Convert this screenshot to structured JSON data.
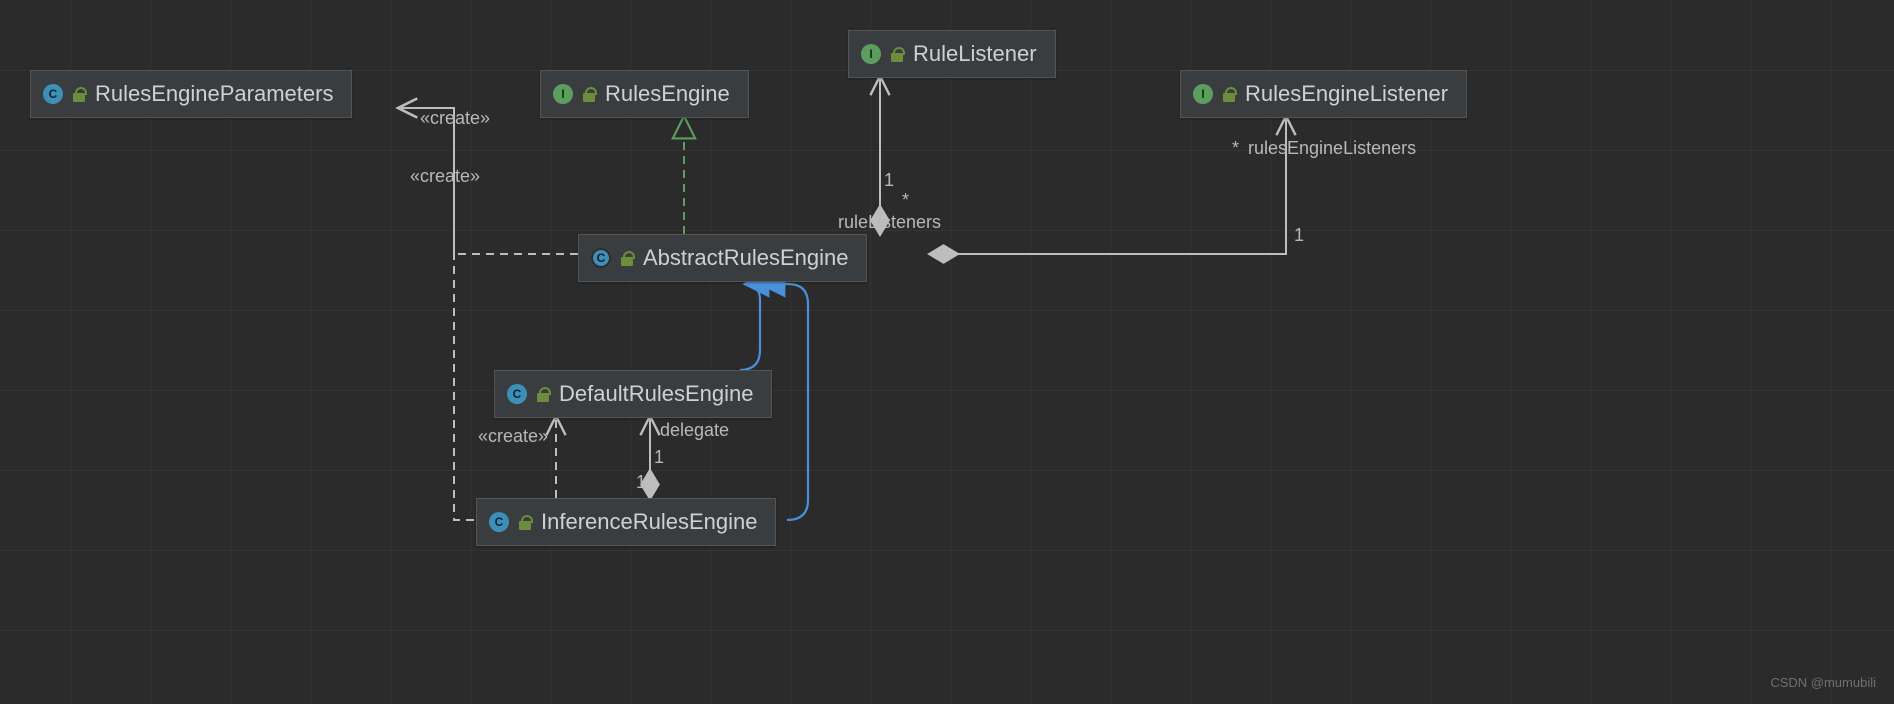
{
  "nodes": {
    "rules_engine_parameters": {
      "label": "RulesEngineParameters",
      "kind": "C"
    },
    "rules_engine": {
      "label": "RulesEngine",
      "kind": "I"
    },
    "rule_listener": {
      "label": "RuleListener",
      "kind": "I"
    },
    "rules_engine_listener": {
      "label": "RulesEngineListener",
      "kind": "I"
    },
    "abstract_rules_engine": {
      "label": "AbstractRulesEngine",
      "kind": "C"
    },
    "default_rules_engine": {
      "label": "DefaultRulesEngine",
      "kind": "C"
    },
    "inference_rules_engine": {
      "label": "InferenceRulesEngine",
      "kind": "C"
    }
  },
  "edge_labels": {
    "create1": "«create»",
    "create2": "«create»",
    "create3": "«create»",
    "rule_listeners_role": "ruleListeners",
    "rule_listeners_card_near": "1",
    "rule_listeners_card_far": "*",
    "engine_listeners_role": "rulesEngineListeners",
    "engine_listeners_card_near": "1",
    "engine_listeners_card_far": "*",
    "delegate_role": "delegate",
    "delegate_card_top": "1",
    "delegate_card_bottom": "1"
  },
  "watermark": "CSDN @mumubili"
}
